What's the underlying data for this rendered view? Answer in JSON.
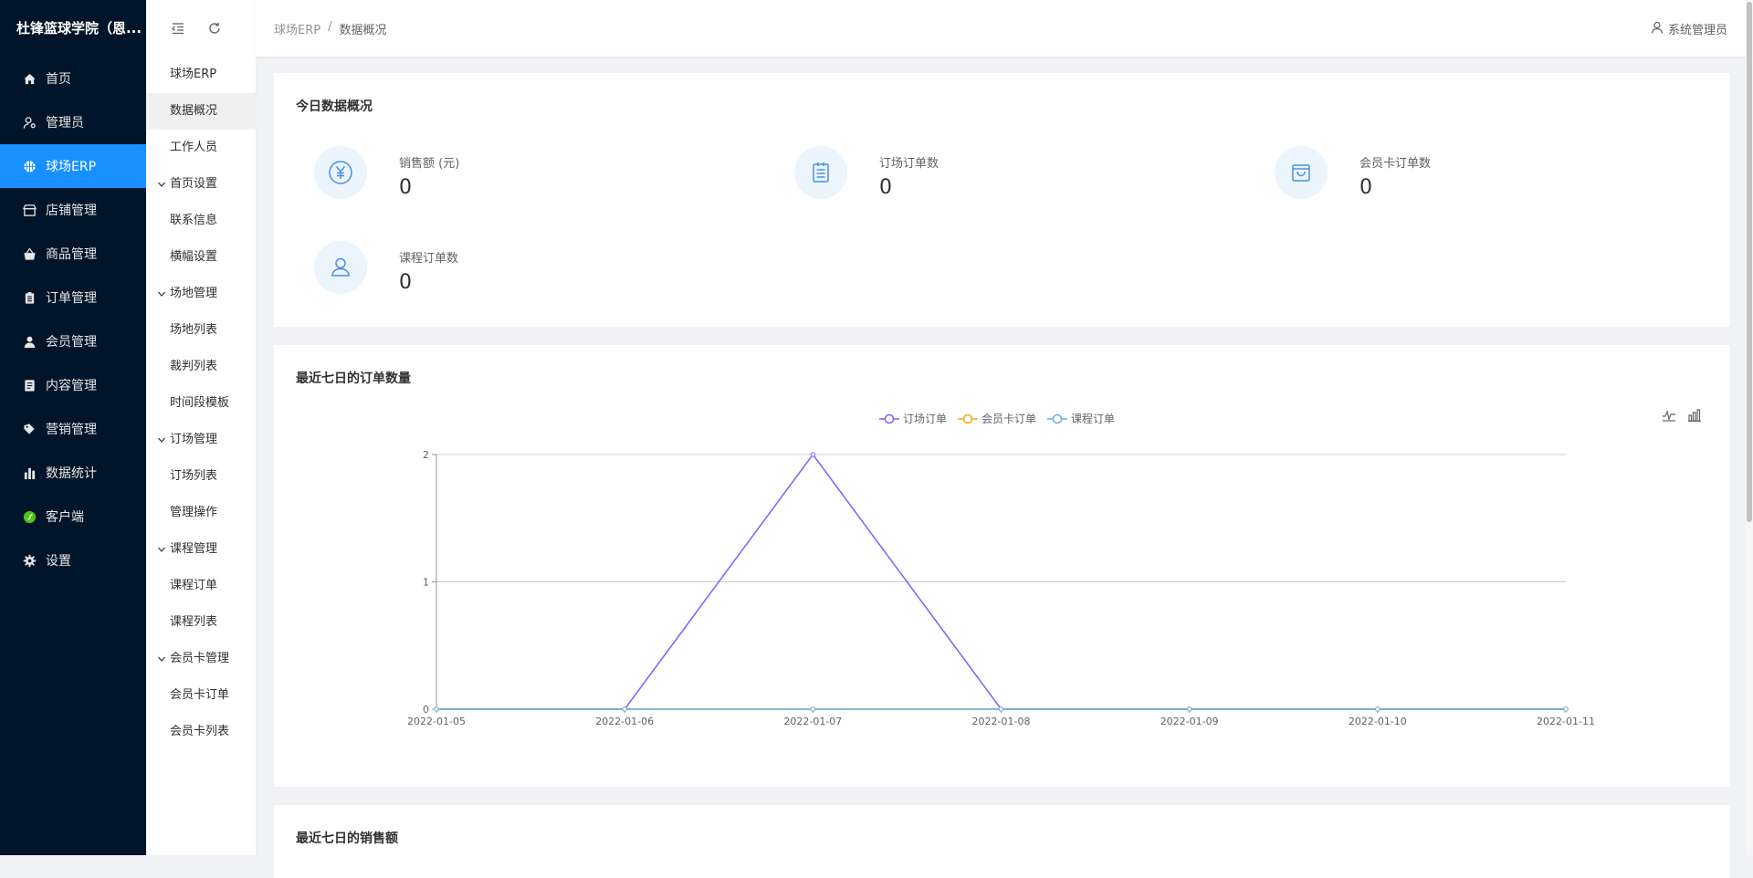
{
  "app": {
    "brand": "杜锋篮球学院（恩..."
  },
  "sidebar": {
    "items": [
      {
        "label": "首页",
        "icon": "home-icon"
      },
      {
        "label": "管理员",
        "icon": "admin-user-icon"
      },
      {
        "label": "球场ERP",
        "icon": "basketball-icon",
        "active": true
      },
      {
        "label": "店铺管理",
        "icon": "shop-icon"
      },
      {
        "label": "商品管理",
        "icon": "basket-icon"
      },
      {
        "label": "订单管理",
        "icon": "clipboard-icon"
      },
      {
        "label": "会员管理",
        "icon": "user-icon"
      },
      {
        "label": "内容管理",
        "icon": "document-icon"
      },
      {
        "label": "营销管理",
        "icon": "tag-icon"
      },
      {
        "label": "数据统计",
        "icon": "bar-chart-icon"
      },
      {
        "label": "客户端",
        "icon": "wechat-icon"
      },
      {
        "label": "设置",
        "icon": "gear-icon"
      }
    ]
  },
  "subnav": {
    "items": [
      {
        "label": "球场ERP",
        "kind": "item"
      },
      {
        "label": "数据概况",
        "kind": "item",
        "active": true
      },
      {
        "label": "工作人员",
        "kind": "item"
      },
      {
        "label": "首页设置",
        "kind": "group"
      },
      {
        "label": "联系信息",
        "kind": "item"
      },
      {
        "label": "横幅设置",
        "kind": "item"
      },
      {
        "label": "场地管理",
        "kind": "group"
      },
      {
        "label": "场地列表",
        "kind": "item"
      },
      {
        "label": "裁判列表",
        "kind": "item"
      },
      {
        "label": "时间段模板",
        "kind": "item"
      },
      {
        "label": "订场管理",
        "kind": "group"
      },
      {
        "label": "订场列表",
        "kind": "item"
      },
      {
        "label": "管理操作",
        "kind": "item"
      },
      {
        "label": "课程管理",
        "kind": "group"
      },
      {
        "label": "课程订单",
        "kind": "item"
      },
      {
        "label": "课程列表",
        "kind": "item"
      },
      {
        "label": "会员卡管理",
        "kind": "group"
      },
      {
        "label": "会员卡订单",
        "kind": "item"
      },
      {
        "label": "会员卡列表",
        "kind": "item"
      }
    ]
  },
  "header": {
    "breadcrumb": [
      "球场ERP",
      "/",
      "数据概况"
    ],
    "user": "系统管理员"
  },
  "today": {
    "title": "今日数据概况",
    "stats": [
      {
        "label": "销售额 (元)",
        "value": "0",
        "icon": "yen-icon"
      },
      {
        "label": "订场订单数",
        "value": "0",
        "icon": "list-icon"
      },
      {
        "label": "会员卡订单数",
        "value": "0",
        "icon": "bag-icon"
      },
      {
        "label": "课程订单数",
        "value": "0",
        "icon": "person-icon"
      }
    ]
  },
  "orders_card": {
    "title": "最近七日的订单数量"
  },
  "sales_card": {
    "title": "最近七日的销售额"
  },
  "colors": {
    "sidebar_bg": "#001529",
    "accent": "#1890ff",
    "series_booking": "#7b61ff",
    "series_member": "#f5a623",
    "series_course": "#5fb0e8"
  },
  "chart_data": {
    "type": "line",
    "title": "最近七日的订单数量",
    "categories": [
      "2022-01-05",
      "2022-01-06",
      "2022-01-07",
      "2022-01-08",
      "2022-01-09",
      "2022-01-10",
      "2022-01-11"
    ],
    "series": [
      {
        "name": "订场订单",
        "values": [
          0,
          0,
          2,
          0,
          0,
          0,
          0
        ],
        "color": "#7b61ff"
      },
      {
        "name": "会员卡订单",
        "values": [
          0,
          0,
          0,
          0,
          0,
          0,
          0
        ],
        "color": "#f5a623"
      },
      {
        "name": "课程订单",
        "values": [
          0,
          0,
          0,
          0,
          0,
          0,
          0
        ],
        "color": "#5fb0e8"
      }
    ],
    "yticks": [
      "0",
      "1",
      "2"
    ],
    "ylim": [
      0,
      2
    ],
    "grid": true,
    "legend": "top-center"
  }
}
